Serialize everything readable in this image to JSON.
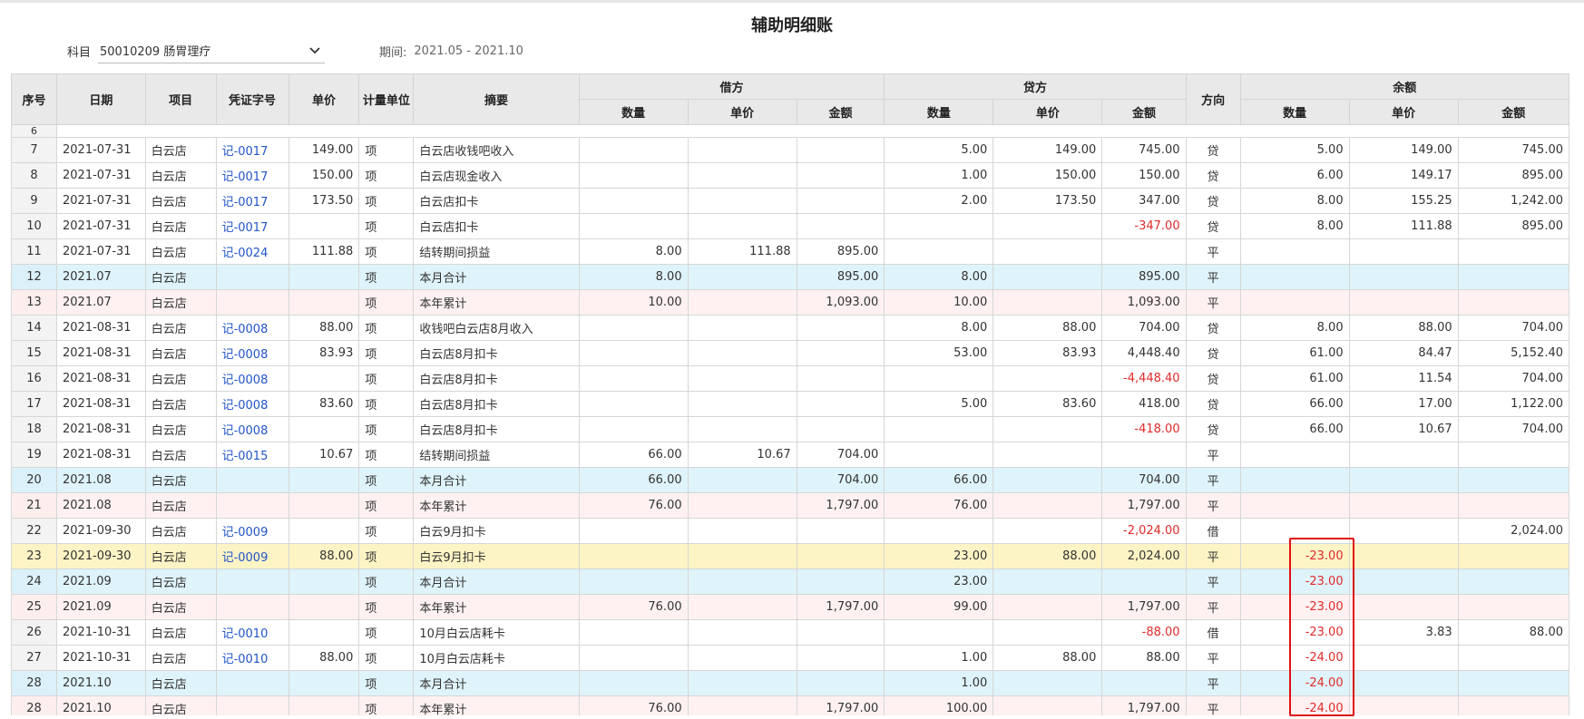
{
  "title": "辅助明细账",
  "filter": {
    "subject_label": "科目",
    "subject_value": "50010209 肠胃理疗",
    "period_label": "期间:",
    "period_value": "2021.05 - 2021.10"
  },
  "headers": {
    "seq": "序号",
    "date": "日期",
    "item": "项目",
    "voucher": "凭证字号",
    "price": "单价",
    "unit": "计量单位",
    "summary": "摘要",
    "debit": "借方",
    "credit": "贷方",
    "direction": "方向",
    "balance": "余额",
    "qty": "数量",
    "unit_price": "单价",
    "amount": "金额"
  },
  "partial_seq": "6",
  "rows": [
    {
      "seq": "7",
      "date": "2021-07-31",
      "item": "白云店",
      "voucher": "记-0017",
      "price": "149.00",
      "unit": "项",
      "summary": "白云店收钱吧收入",
      "d_qty": "",
      "d_price": "",
      "d_amt": "",
      "c_qty": "5.00",
      "c_price": "149.00",
      "c_amt": "745.00",
      "dir": "贷",
      "b_qty": "5.00",
      "b_price": "149.00",
      "b_amt": "745.00"
    },
    {
      "seq": "8",
      "date": "2021-07-31",
      "item": "白云店",
      "voucher": "记-0017",
      "price": "150.00",
      "unit": "项",
      "summary": "白云店现金收入",
      "d_qty": "",
      "d_price": "",
      "d_amt": "",
      "c_qty": "1.00",
      "c_price": "150.00",
      "c_amt": "150.00",
      "dir": "贷",
      "b_qty": "6.00",
      "b_price": "149.17",
      "b_amt": "895.00"
    },
    {
      "seq": "9",
      "date": "2021-07-31",
      "item": "白云店",
      "voucher": "记-0017",
      "price": "173.50",
      "unit": "项",
      "summary": "白云店扣卡",
      "d_qty": "",
      "d_price": "",
      "d_amt": "",
      "c_qty": "2.00",
      "c_price": "173.50",
      "c_amt": "347.00",
      "dir": "贷",
      "b_qty": "8.00",
      "b_price": "155.25",
      "b_amt": "1,242.00"
    },
    {
      "seq": "10",
      "date": "2021-07-31",
      "item": "白云店",
      "voucher": "记-0017",
      "price": "",
      "unit": "项",
      "summary": "白云店扣卡",
      "d_qty": "",
      "d_price": "",
      "d_amt": "",
      "c_qty": "",
      "c_price": "",
      "c_amt": "-347.00",
      "dir": "贷",
      "b_qty": "8.00",
      "b_price": "111.88",
      "b_amt": "895.00"
    },
    {
      "seq": "11",
      "date": "2021-07-31",
      "item": "白云店",
      "voucher": "记-0024",
      "price": "111.88",
      "unit": "项",
      "summary": "结转期间损益",
      "d_qty": "8.00",
      "d_price": "111.88",
      "d_amt": "895.00",
      "c_qty": "",
      "c_price": "",
      "c_amt": "",
      "dir": "平",
      "b_qty": "",
      "b_price": "",
      "b_amt": ""
    },
    {
      "seq": "12",
      "date": "2021.07",
      "item": "白云店",
      "voucher": "",
      "price": "",
      "unit": "项",
      "summary": "本月合计",
      "d_qty": "8.00",
      "d_price": "",
      "d_amt": "895.00",
      "c_qty": "8.00",
      "c_price": "",
      "c_amt": "895.00",
      "dir": "平",
      "b_qty": "",
      "b_price": "",
      "b_amt": ""
    },
    {
      "seq": "13",
      "date": "2021.07",
      "item": "白云店",
      "voucher": "",
      "price": "",
      "unit": "项",
      "summary": "本年累计",
      "d_qty": "10.00",
      "d_price": "",
      "d_amt": "1,093.00",
      "c_qty": "10.00",
      "c_price": "",
      "c_amt": "1,093.00",
      "dir": "平",
      "b_qty": "",
      "b_price": "",
      "b_amt": ""
    },
    {
      "seq": "14",
      "date": "2021-08-31",
      "item": "白云店",
      "voucher": "记-0008",
      "price": "88.00",
      "unit": "项",
      "summary": "收钱吧白云店8月收入",
      "d_qty": "",
      "d_price": "",
      "d_amt": "",
      "c_qty": "8.00",
      "c_price": "88.00",
      "c_amt": "704.00",
      "dir": "贷",
      "b_qty": "8.00",
      "b_price": "88.00",
      "b_amt": "704.00"
    },
    {
      "seq": "15",
      "date": "2021-08-31",
      "item": "白云店",
      "voucher": "记-0008",
      "price": "83.93",
      "unit": "项",
      "summary": "白云店8月扣卡",
      "d_qty": "",
      "d_price": "",
      "d_amt": "",
      "c_qty": "53.00",
      "c_price": "83.93",
      "c_amt": "4,448.40",
      "dir": "贷",
      "b_qty": "61.00",
      "b_price": "84.47",
      "b_amt": "5,152.40"
    },
    {
      "seq": "16",
      "date": "2021-08-31",
      "item": "白云店",
      "voucher": "记-0008",
      "price": "",
      "unit": "项",
      "summary": "白云店8月扣卡",
      "d_qty": "",
      "d_price": "",
      "d_amt": "",
      "c_qty": "",
      "c_price": "",
      "c_amt": "-4,448.40",
      "dir": "贷",
      "b_qty": "61.00",
      "b_price": "11.54",
      "b_amt": "704.00"
    },
    {
      "seq": "17",
      "date": "2021-08-31",
      "item": "白云店",
      "voucher": "记-0008",
      "price": "83.60",
      "unit": "项",
      "summary": "白云店8月扣卡",
      "d_qty": "",
      "d_price": "",
      "d_amt": "",
      "c_qty": "5.00",
      "c_price": "83.60",
      "c_amt": "418.00",
      "dir": "贷",
      "b_qty": "66.00",
      "b_price": "17.00",
      "b_amt": "1,122.00"
    },
    {
      "seq": "18",
      "date": "2021-08-31",
      "item": "白云店",
      "voucher": "记-0008",
      "price": "",
      "unit": "项",
      "summary": "白云店8月扣卡",
      "d_qty": "",
      "d_price": "",
      "d_amt": "",
      "c_qty": "",
      "c_price": "",
      "c_amt": "-418.00",
      "dir": "贷",
      "b_qty": "66.00",
      "b_price": "10.67",
      "b_amt": "704.00"
    },
    {
      "seq": "19",
      "date": "2021-08-31",
      "item": "白云店",
      "voucher": "记-0015",
      "price": "10.67",
      "unit": "项",
      "summary": "结转期间损益",
      "d_qty": "66.00",
      "d_price": "10.67",
      "d_amt": "704.00",
      "c_qty": "",
      "c_price": "",
      "c_amt": "",
      "dir": "平",
      "b_qty": "",
      "b_price": "",
      "b_amt": ""
    },
    {
      "seq": "20",
      "date": "2021.08",
      "item": "白云店",
      "voucher": "",
      "price": "",
      "unit": "项",
      "summary": "本月合计",
      "d_qty": "66.00",
      "d_price": "",
      "d_amt": "704.00",
      "c_qty": "66.00",
      "c_price": "",
      "c_amt": "704.00",
      "dir": "平",
      "b_qty": "",
      "b_price": "",
      "b_amt": ""
    },
    {
      "seq": "21",
      "date": "2021.08",
      "item": "白云店",
      "voucher": "",
      "price": "",
      "unit": "项",
      "summary": "本年累计",
      "d_qty": "76.00",
      "d_price": "",
      "d_amt": "1,797.00",
      "c_qty": "76.00",
      "c_price": "",
      "c_amt": "1,797.00",
      "dir": "平",
      "b_qty": "",
      "b_price": "",
      "b_amt": ""
    },
    {
      "seq": "22",
      "date": "2021-09-30",
      "item": "白云店",
      "voucher": "记-0009",
      "price": "",
      "unit": "项",
      "summary": "白云9月扣卡",
      "d_qty": "",
      "d_price": "",
      "d_amt": "",
      "c_qty": "",
      "c_price": "",
      "c_amt": "-2,024.00",
      "dir": "借",
      "b_qty": "",
      "b_price": "",
      "b_amt": "2,024.00"
    },
    {
      "seq": "23",
      "date": "2021-09-30",
      "item": "白云店",
      "voucher": "记-0009",
      "price": "88.00",
      "unit": "项",
      "summary": "白云9月扣卡",
      "d_qty": "",
      "d_price": "",
      "d_amt": "",
      "c_qty": "23.00",
      "c_price": "88.00",
      "c_amt": "2,024.00",
      "dir": "平",
      "b_qty": "-23.00",
      "b_price": "",
      "b_amt": ""
    },
    {
      "seq": "24",
      "date": "2021.09",
      "item": "白云店",
      "voucher": "",
      "price": "",
      "unit": "项",
      "summary": "本月合计",
      "d_qty": "",
      "d_price": "",
      "d_amt": "",
      "c_qty": "23.00",
      "c_price": "",
      "c_amt": "",
      "dir": "平",
      "b_qty": "-23.00",
      "b_price": "",
      "b_amt": ""
    },
    {
      "seq": "25",
      "date": "2021.09",
      "item": "白云店",
      "voucher": "",
      "price": "",
      "unit": "项",
      "summary": "本年累计",
      "d_qty": "76.00",
      "d_price": "",
      "d_amt": "1,797.00",
      "c_qty": "99.00",
      "c_price": "",
      "c_amt": "1,797.00",
      "dir": "平",
      "b_qty": "-23.00",
      "b_price": "",
      "b_amt": ""
    },
    {
      "seq": "26",
      "date": "2021-10-31",
      "item": "白云店",
      "voucher": "记-0010",
      "price": "",
      "unit": "项",
      "summary": "10月白云店耗卡",
      "d_qty": "",
      "d_price": "",
      "d_amt": "",
      "c_qty": "",
      "c_price": "",
      "c_amt": "-88.00",
      "dir": "借",
      "b_qty": "-23.00",
      "b_price": "3.83",
      "b_amt": "88.00"
    },
    {
      "seq": "27",
      "date": "2021-10-31",
      "item": "白云店",
      "voucher": "记-0010",
      "price": "88.00",
      "unit": "项",
      "summary": "10月白云店耗卡",
      "d_qty": "",
      "d_price": "",
      "d_amt": "",
      "c_qty": "1.00",
      "c_price": "88.00",
      "c_amt": "88.00",
      "dir": "平",
      "b_qty": "-24.00",
      "b_price": "",
      "b_amt": ""
    },
    {
      "seq": "28",
      "date": "2021.10",
      "item": "白云店",
      "voucher": "",
      "price": "",
      "unit": "项",
      "summary": "本月合计",
      "d_qty": "",
      "d_price": "",
      "d_amt": "",
      "c_qty": "1.00",
      "c_price": "",
      "c_amt": "",
      "dir": "平",
      "b_qty": "-24.00",
      "b_price": "",
      "b_amt": ""
    },
    {
      "seq": "28",
      "date": "2021.10",
      "item": "白云店",
      "voucher": "",
      "price": "",
      "unit": "项",
      "summary": "本年累计",
      "d_qty": "76.00",
      "d_price": "",
      "d_amt": "1,797.00",
      "c_qty": "100.00",
      "c_price": "",
      "c_amt": "1,797.00",
      "dir": "平",
      "b_qty": "-24.00",
      "b_price": "",
      "b_amt": ""
    }
  ],
  "colors": {
    "negative": "#e02b2b",
    "voucher_link": "#2254c9",
    "month_total_bg": "#dff3fa",
    "year_total_bg": "#fff1f1",
    "selected_bg": "#fdf4c5",
    "highlight_border": "#e01010"
  }
}
